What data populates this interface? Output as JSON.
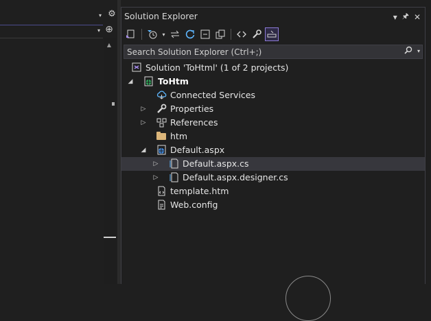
{
  "left_editor": {
    "menu_caret": "▾",
    "gear_glyph": "⚙",
    "split_glyph": "⊕",
    "dropdown_caret": "▾",
    "scroll_up_glyph": "▲"
  },
  "solution_explorer": {
    "title": "Solution Explorer",
    "title_buttons": {
      "menu": "▾",
      "pin": "⊥",
      "close": "✕"
    },
    "toolbar": [
      {
        "name": "switch-views-icon",
        "glyph": "⇄"
      },
      {
        "name": "pending-changes-filter-icon",
        "glyph": "◷"
      },
      {
        "name": "sync-icon",
        "glyph": "⇋"
      },
      {
        "name": "refresh-icon",
        "glyph": "↻"
      },
      {
        "name": "collapse-all-icon",
        "glyph": "⊟"
      },
      {
        "name": "show-all-files-icon",
        "glyph": "❐"
      },
      {
        "name": "view-code-icon",
        "glyph": "‹›"
      },
      {
        "name": "properties-icon",
        "glyph": "🔧"
      },
      {
        "name": "preview-selected-items-icon",
        "glyph": "⊏"
      }
    ],
    "search": {
      "placeholder": "Search Solution Explorer (Ctrl+;)",
      "icon": "⌕",
      "caret": "▾"
    },
    "tree": [
      {
        "label": "Solution 'ToHtml' (1 of 2 projects)",
        "depth": 0,
        "icon": "solution"
      },
      {
        "label": "ToHtm",
        "depth": 1,
        "icon": "project",
        "expander": "◢",
        "bold": true
      },
      {
        "label": "Connected Services",
        "depth": 2,
        "icon": "cloud"
      },
      {
        "label": "Properties",
        "depth": 2,
        "icon": "wrench",
        "expander": "▷"
      },
      {
        "label": "References",
        "depth": 2,
        "icon": "refs",
        "expander": "▷"
      },
      {
        "label": "htm",
        "depth": 2,
        "icon": "folder"
      },
      {
        "label": "Default.aspx",
        "depth": 2,
        "icon": "globe",
        "expander": "◢"
      },
      {
        "label": "Default.aspx.cs",
        "depth": 3,
        "icon": "csfile",
        "expander": "▷",
        "selected": true
      },
      {
        "label": "Default.aspx.designer.cs",
        "depth": 3,
        "icon": "csfile",
        "expander": "▷"
      },
      {
        "label": "template.htm",
        "depth": 2,
        "icon": "htm"
      },
      {
        "label": "Web.config",
        "depth": 2,
        "icon": "config"
      }
    ],
    "glyphs": {
      "cloud": "☁",
      "wrench": "🔧",
      "refs": "▣▣",
      "globe": "🌐",
      "htm": "‹›"
    }
  },
  "colors": {
    "accent": "#8d7bd8",
    "selection": "#37373d",
    "background": "#1f1f1f"
  }
}
